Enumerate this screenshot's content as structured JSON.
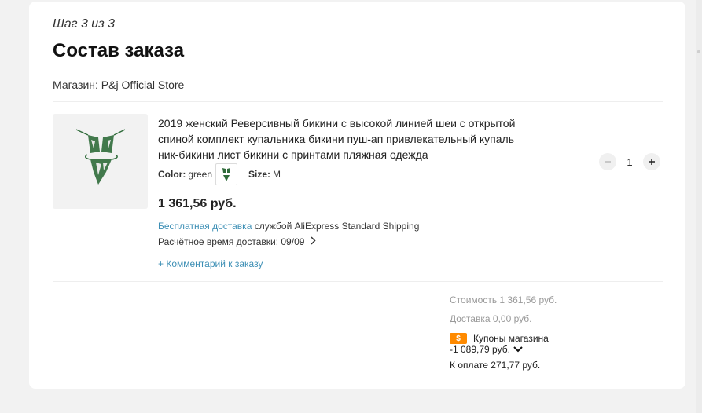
{
  "step": "Шаг 3 из 3",
  "title": "Состав заказа",
  "store": "Магазин: P&j Official Store",
  "product": {
    "title": "2019 женский Реверсивный бикини с высокой линией шеи с открытой спиной комплект купальника бикини пуш-ап привлекательный купальник-бикини лист бикини с принтами пляжная одежда",
    "color_label": "Color:",
    "color_value": "green",
    "size_label": "Size:",
    "size_value": "M",
    "price": "1 361,56 руб.",
    "delivery_free": "Бесплатная доставка",
    "delivery_service": "службой AliExpress Standard Shipping",
    "eta": "Расчётное время доставки: 09/09",
    "comment": "+ Комментарий к заказу",
    "quantity": "1"
  },
  "summary": {
    "cost_label": "Стоимость",
    "cost_value": "1 361,56 руб.",
    "delivery_label": "Доставка",
    "delivery_value": "0,00 руб.",
    "coupon_label": "Купоны магазина",
    "coupon_value": "-1 089,79 руб.",
    "total_label": "К оплате",
    "total_value": "271,77 руб."
  },
  "colors": {
    "link": "#3d8fb5",
    "coupon_badge": "#ff8a00",
    "leaf_green": "#2f6b3a"
  },
  "icons": {
    "minus": "minus-icon",
    "plus": "plus-icon",
    "chevron_right": "chevron-right-icon",
    "chevron_down": "chevron-down-icon",
    "coupon": "coupon-icon"
  }
}
